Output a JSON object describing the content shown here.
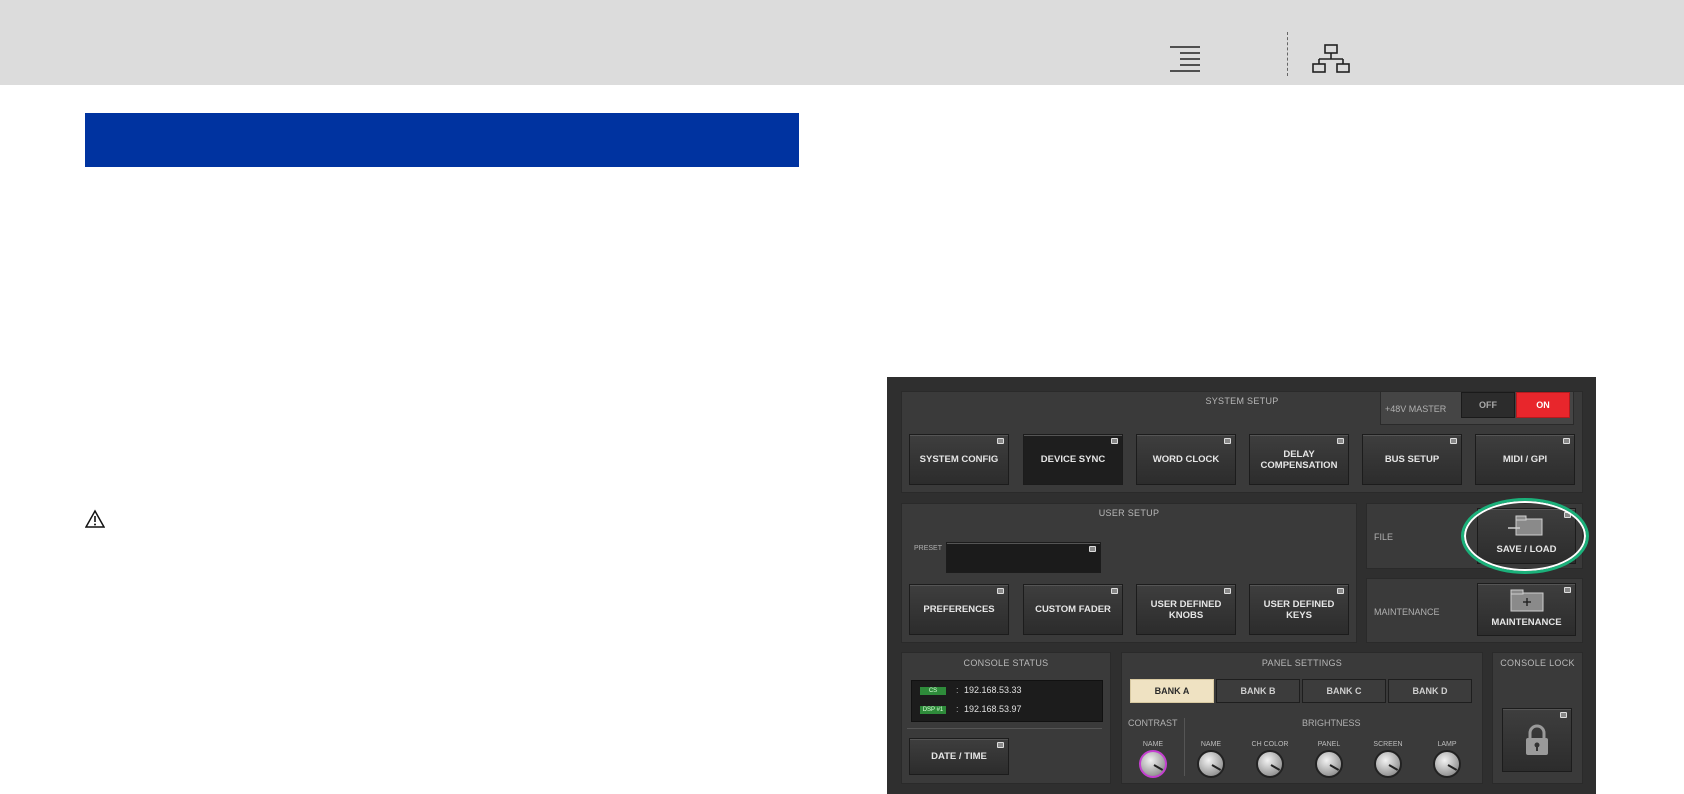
{
  "toolbar": {
    "toc_icon": "table-of-contents-icon",
    "sitemap_icon": "sitemap-icon"
  },
  "warning_icon": "warning-triangle-icon",
  "console": {
    "system_setup": {
      "title": "SYSTEM SETUP",
      "phantom_label": "+48V MASTER",
      "off_label": "OFF",
      "on_label": "ON",
      "buttons": {
        "system_config": "SYSTEM CONFIG",
        "device_sync": "DEVICE SYNC",
        "word_clock": "WORD CLOCK",
        "delay_comp_1": "DELAY",
        "delay_comp_2": "COMPENSATION",
        "bus_setup": "BUS SETUP",
        "midi_gpi": "MIDI / GPI"
      }
    },
    "user_setup": {
      "title": "USER SETUP",
      "preset_label": "PRESET",
      "buttons": {
        "preferences": "PREFERENCES",
        "custom_fader": "CUSTOM FADER",
        "udk_knobs_1": "USER DEFINED",
        "udk_knobs_2": "KNOBS",
        "udk_keys_1": "USER DEFINED",
        "udk_keys_2": "KEYS"
      }
    },
    "file": {
      "label": "FILE",
      "save_load": "SAVE / LOAD"
    },
    "maintenance": {
      "label": "MAINTENANCE",
      "button": "MAINTENANCE"
    },
    "console_status": {
      "title": "CONSOLE STATUS",
      "cs_tag": "CS",
      "cs_ip": "192.168.53.33",
      "dsp_tag": "DSP #1",
      "dsp_ip": "192.168.53.97",
      "date_time": "DATE / TIME"
    },
    "panel_settings": {
      "title": "PANEL SETTINGS",
      "banks": [
        "BANK A",
        "BANK B",
        "BANK C",
        "BANK D"
      ],
      "contrast_label": "CONTRAST",
      "brightness_label": "BRIGHTNESS",
      "knobs": [
        "NAME",
        "NAME",
        "CH COLOR",
        "PANEL",
        "SCREEN",
        "LAMP"
      ]
    },
    "console_lock": {
      "title": "CONSOLE LOCK"
    },
    "colors": {
      "on_red": "#e8262c",
      "highlight_green": "#1bb07a",
      "title_blue": "#0033a0"
    }
  }
}
